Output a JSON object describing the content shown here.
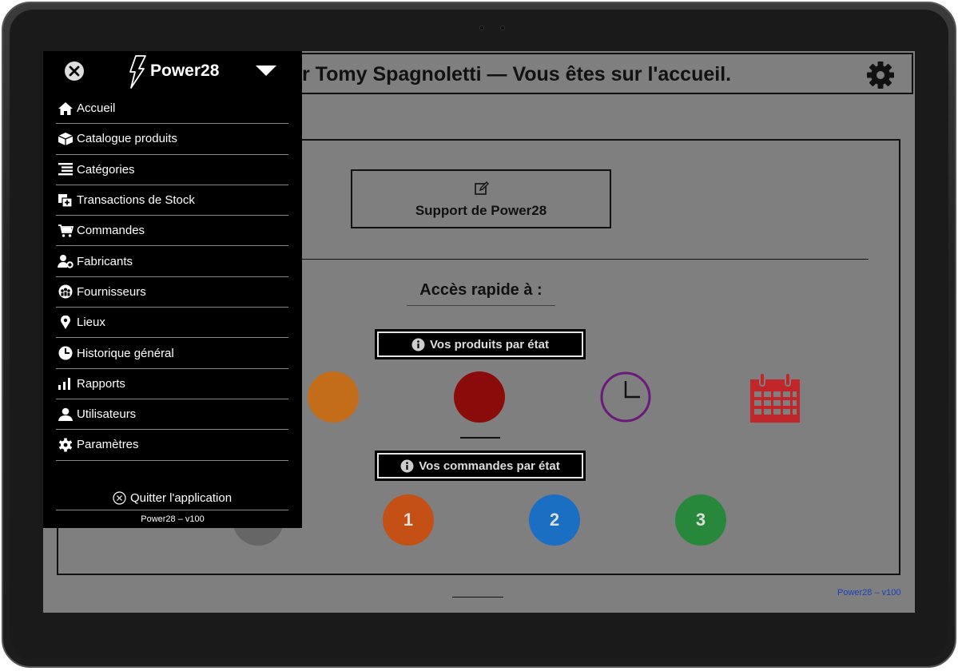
{
  "header": {
    "title": "r Tomy Spagnoletti — Vous êtes sur l'accueil.",
    "settings_icon": "gear-icon"
  },
  "support": {
    "label": "Support de Power28",
    "icon": "edit-icon"
  },
  "quick_access": {
    "title": "Accès rapide à :",
    "products_button": "Vos produits par état",
    "orders_button": "Vos commandes par état",
    "product_states": [
      {
        "icon": "orange-circle",
        "color": "#c36d1a"
      },
      {
        "icon": "red-circle",
        "color": "#8b0a0a"
      },
      {
        "icon": "clock-icon",
        "color": "#6a1a7a"
      },
      {
        "icon": "calendar-icon",
        "color": "#c0262a"
      }
    ],
    "order_states": [
      {
        "label": "1",
        "color": "#c45016"
      },
      {
        "label": "2",
        "color": "#1b6fc2"
      },
      {
        "label": "3",
        "color": "#27883c"
      }
    ]
  },
  "footer": {
    "version": "Power28 – v100"
  },
  "sidebar": {
    "brand": "Power28",
    "items": [
      {
        "label": "Accueil",
        "icon": "home-icon"
      },
      {
        "label": "Catalogue produits",
        "icon": "box-icon"
      },
      {
        "label": "Catégories",
        "icon": "list-icon"
      },
      {
        "label": "Transactions de Stock",
        "icon": "plus-square-icon"
      },
      {
        "label": "Commandes",
        "icon": "cart-icon"
      },
      {
        "label": "Fabricants",
        "icon": "user-gear-icon"
      },
      {
        "label": "Fournisseurs",
        "icon": "group-icon"
      },
      {
        "label": "Lieux",
        "icon": "map-pin-icon"
      },
      {
        "label": "Historique général",
        "icon": "clock-icon"
      },
      {
        "label": "Rapports",
        "icon": "bar-chart-icon"
      },
      {
        "label": "Utilisateurs",
        "icon": "user-icon"
      },
      {
        "label": "Paramètres",
        "icon": "gear-icon"
      }
    ],
    "quit_label": "Quitter l'application",
    "version": "Power28 – v100"
  },
  "colors": {
    "screen_bg": "#7f7f7f",
    "sidebar_bg": "#000000",
    "link_blue": "#1a3fbf"
  }
}
